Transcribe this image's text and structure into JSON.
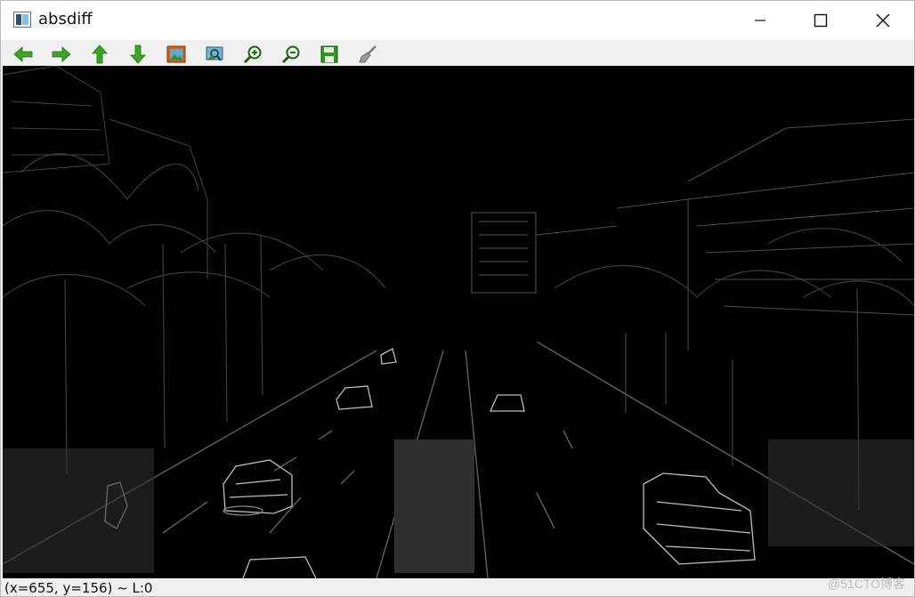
{
  "window": {
    "title": "absdiff"
  },
  "toolbar": {
    "buttons": [
      {
        "name": "pan-left",
        "icon": "arrow-left-icon"
      },
      {
        "name": "pan-right",
        "icon": "arrow-right-icon"
      },
      {
        "name": "pan-up",
        "icon": "arrow-up-icon"
      },
      {
        "name": "pan-down",
        "icon": "arrow-down-icon"
      },
      {
        "name": "zoom-fit",
        "icon": "image-icon"
      },
      {
        "name": "zoom-original",
        "icon": "zoom-image-icon"
      },
      {
        "name": "zoom-in",
        "icon": "zoom-in-icon"
      },
      {
        "name": "zoom-out",
        "icon": "zoom-out-icon"
      },
      {
        "name": "save",
        "icon": "save-icon"
      },
      {
        "name": "properties",
        "icon": "brush-icon"
      }
    ]
  },
  "status": {
    "text": "(x=655, y=156) ~ L:0"
  },
  "watermark": "@51CTO博客",
  "colors": {
    "canvas": "#000000",
    "edges": "#8a8a8a",
    "toolbar_green": "#2e9b1f"
  }
}
